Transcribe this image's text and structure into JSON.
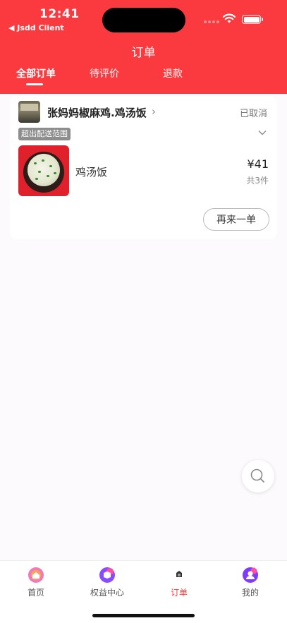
{
  "status_bar": {
    "time": "12:41",
    "back_label": "◀ Jsdd Client"
  },
  "header": {
    "title": "订单"
  },
  "tabs": [
    {
      "label": "全部订单",
      "active": true
    },
    {
      "label": "待评价",
      "active": false
    },
    {
      "label": "退款",
      "active": false
    }
  ],
  "order": {
    "shop_name": "张妈妈椒麻鸡.鸡汤饭",
    "status": "已取消",
    "badge": "超出配送范围",
    "item_name": "鸡汤饭",
    "price": "¥41",
    "count": "共3件",
    "reorder_label": "再来一单"
  },
  "bottom_nav": [
    {
      "label": "首页",
      "icon": "home-icon",
      "active": false
    },
    {
      "label": "权益中心",
      "icon": "benefits-icon",
      "active": false
    },
    {
      "label": "订单",
      "icon": "orders-icon",
      "active": true
    },
    {
      "label": "我的",
      "icon": "profile-icon",
      "active": false
    }
  ],
  "colors": {
    "brand": "#fb3a3f",
    "background": "#fdfafd"
  }
}
